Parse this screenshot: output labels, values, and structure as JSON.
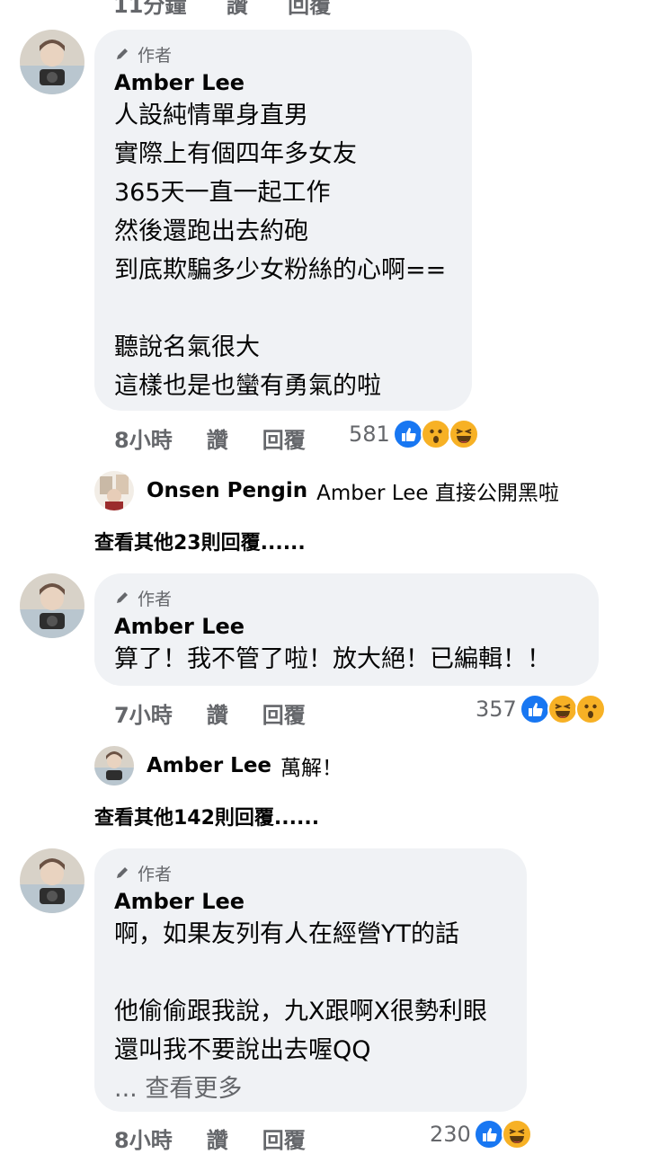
{
  "top_cut": {
    "time": "11分鐘",
    "like": "讚",
    "reply": "回覆"
  },
  "comments": [
    {
      "author_badge": "作者",
      "author": "Amber Lee",
      "text": "人設純情單身直男\n實際上有個四年多女友\n365天一直一起工作\n然後還跑出去約砲\n到底欺騙多少女粉絲的心啊==\n\n聽說名氣很大\n這樣也是也蠻有勇氣的啦",
      "time": "8小時",
      "like": "讚",
      "reply": "回覆",
      "reaction_count": "581",
      "reactions": [
        "like-icon",
        "wow-icon",
        "haha-icon"
      ],
      "reply_preview": {
        "name": "Onsen Pengin",
        "text": "Amber Lee 直接公開黑啦"
      },
      "more_replies": "查看其他23則回覆......"
    },
    {
      "author_badge": "作者",
      "author": "Amber Lee",
      "text": "算了！我不管了啦！放大絕！已編輯！！",
      "time": "7小時",
      "like": "讚",
      "reply": "回覆",
      "reaction_count": "357",
      "reactions": [
        "like-icon",
        "haha-icon",
        "wow-icon"
      ],
      "reply_preview": {
        "name": "Amber Lee",
        "text": "萬解！"
      },
      "more_replies": "查看其他142則回覆......"
    },
    {
      "author_badge": "作者",
      "author": "Amber Lee",
      "text": "啊，如果友列有人在經營YT的話\n\n他偷偷跟我說，九X跟啊X很勢利眼\n還叫我不要說出去喔QQ",
      "see_more": "... 查看更多",
      "time": "8小時",
      "like": "讚",
      "reply": "回覆",
      "reaction_count": "230",
      "reactions": [
        "like-icon",
        "haha-icon"
      ]
    }
  ],
  "colors": {
    "bubble": "#f0f2f5",
    "secondary_text": "#65676b",
    "like_blue": "#1877f2",
    "emoji_yellow": "#f7b125"
  }
}
